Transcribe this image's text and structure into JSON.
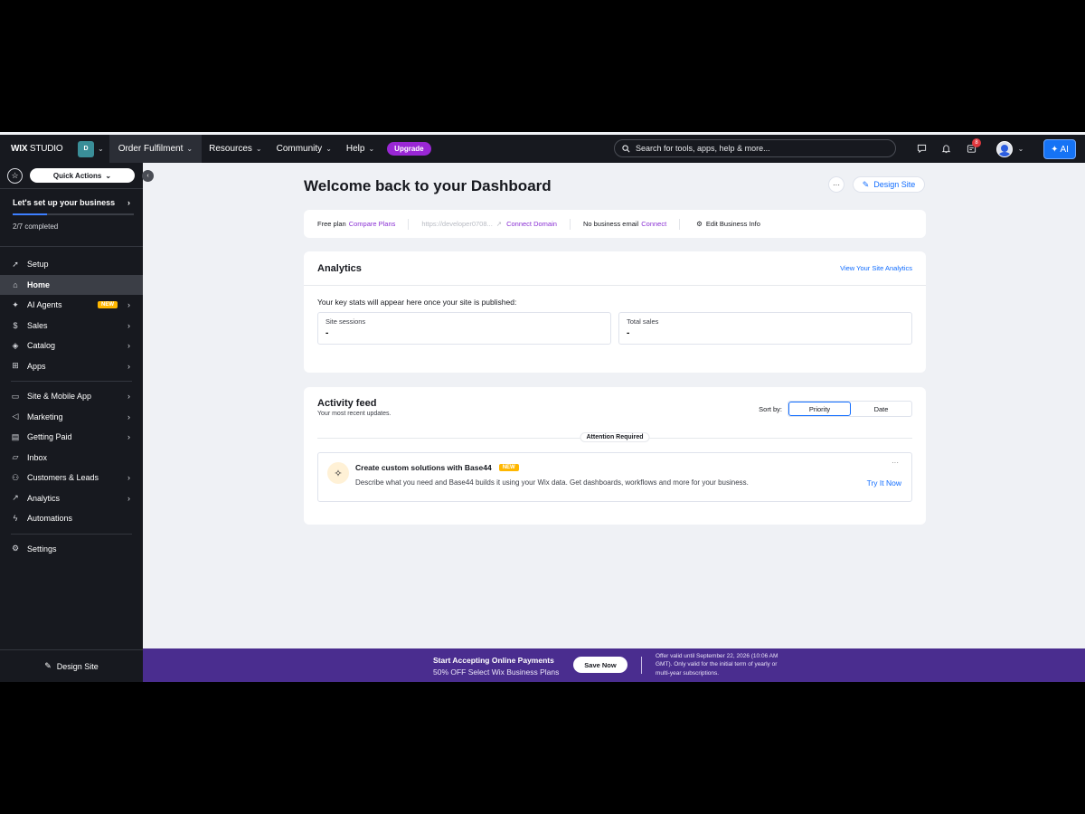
{
  "topbar": {
    "logo_wix": "WIX",
    "logo_studio": "STUDIO",
    "site_initial": "D",
    "site_name": "Order Fulfilment",
    "nav": [
      "Resources",
      "Community",
      "Help"
    ],
    "upgrade": "Upgrade",
    "search_placeholder": "Search for tools, apps, help & more...",
    "notification_count": "8",
    "ai_label": "AI"
  },
  "sidebar": {
    "quick_actions": "Quick Actions",
    "setup_title": "Let's set up your business",
    "setup_count": "2/7 completed",
    "setup_progress": 0.2857,
    "items": [
      {
        "label": "Setup",
        "icon": "rocket-icon",
        "arrow": false,
        "new": false,
        "active": false
      },
      {
        "label": "Home",
        "icon": "home-icon",
        "arrow": false,
        "new": false,
        "active": true
      },
      {
        "label": "AI Agents",
        "icon": "sparkle-icon",
        "arrow": true,
        "new": true,
        "active": false
      },
      {
        "label": "Sales",
        "icon": "dollar-icon",
        "arrow": true,
        "new": false,
        "active": false
      },
      {
        "label": "Catalog",
        "icon": "catalog-icon",
        "arrow": true,
        "new": false,
        "active": false
      },
      {
        "label": "Apps",
        "icon": "apps-icon",
        "arrow": true,
        "new": false,
        "active": false
      }
    ],
    "items2": [
      {
        "label": "Site & Mobile App",
        "icon": "site-icon",
        "arrow": true
      },
      {
        "label": "Marketing",
        "icon": "megaphone-icon",
        "arrow": true
      },
      {
        "label": "Getting Paid",
        "icon": "card-icon",
        "arrow": true
      },
      {
        "label": "Inbox",
        "icon": "inbox-icon",
        "arrow": false
      },
      {
        "label": "Customers & Leads",
        "icon": "people-icon",
        "arrow": true
      },
      {
        "label": "Analytics",
        "icon": "chart-icon",
        "arrow": true
      },
      {
        "label": "Automations",
        "icon": "bolt-icon",
        "arrow": false
      }
    ],
    "settings": "Settings",
    "new_tag": "NEW",
    "design_site": "Design Site"
  },
  "main": {
    "title": "Welcome back to your Dashboard",
    "more": "···",
    "design_site": "Design Site",
    "infobar": {
      "plan": "Free plan",
      "compare": "Compare Plans",
      "url": "https://developer0708...",
      "connect_domain": "Connect Domain",
      "email": "No business email",
      "connect": "Connect",
      "edit": "Edit Business Info"
    },
    "analytics": {
      "title": "Analytics",
      "link": "View Your Site Analytics",
      "desc": "Your key stats will appear here once your site is published:",
      "stats": [
        {
          "label": "Site sessions",
          "value": "-"
        },
        {
          "label": "Total sales",
          "value": "-"
        }
      ]
    },
    "activity": {
      "title": "Activity feed",
      "subtitle": "Your most recent updates.",
      "sort_label": "Sort by:",
      "sort_options": [
        "Priority",
        "Date"
      ],
      "attention": "Attention Required",
      "item_title": "Create custom solutions with Base44",
      "item_new": "NEW",
      "item_desc": "Describe what you need and Base44 builds it using your Wix data. Get dashboards, workflows and more for your business.",
      "item_more": "···",
      "item_cta": "Try It Now"
    }
  },
  "promo": {
    "title": "Start Accepting Online Payments",
    "subtitle": "50% OFF Select Wix Business Plans",
    "button": "Save Now",
    "fine_print": "Offer valid until September 22, 2026 (10:06 AM GMT). Only valid for the initial term of yearly or multi-year subscriptions."
  },
  "colors": {
    "topbar": "#17191f",
    "accent_blue": "#116dff",
    "upgrade_purple": "#9a27d5",
    "promo_purple": "#4a2d8f",
    "new_badge": "#ffb700"
  }
}
